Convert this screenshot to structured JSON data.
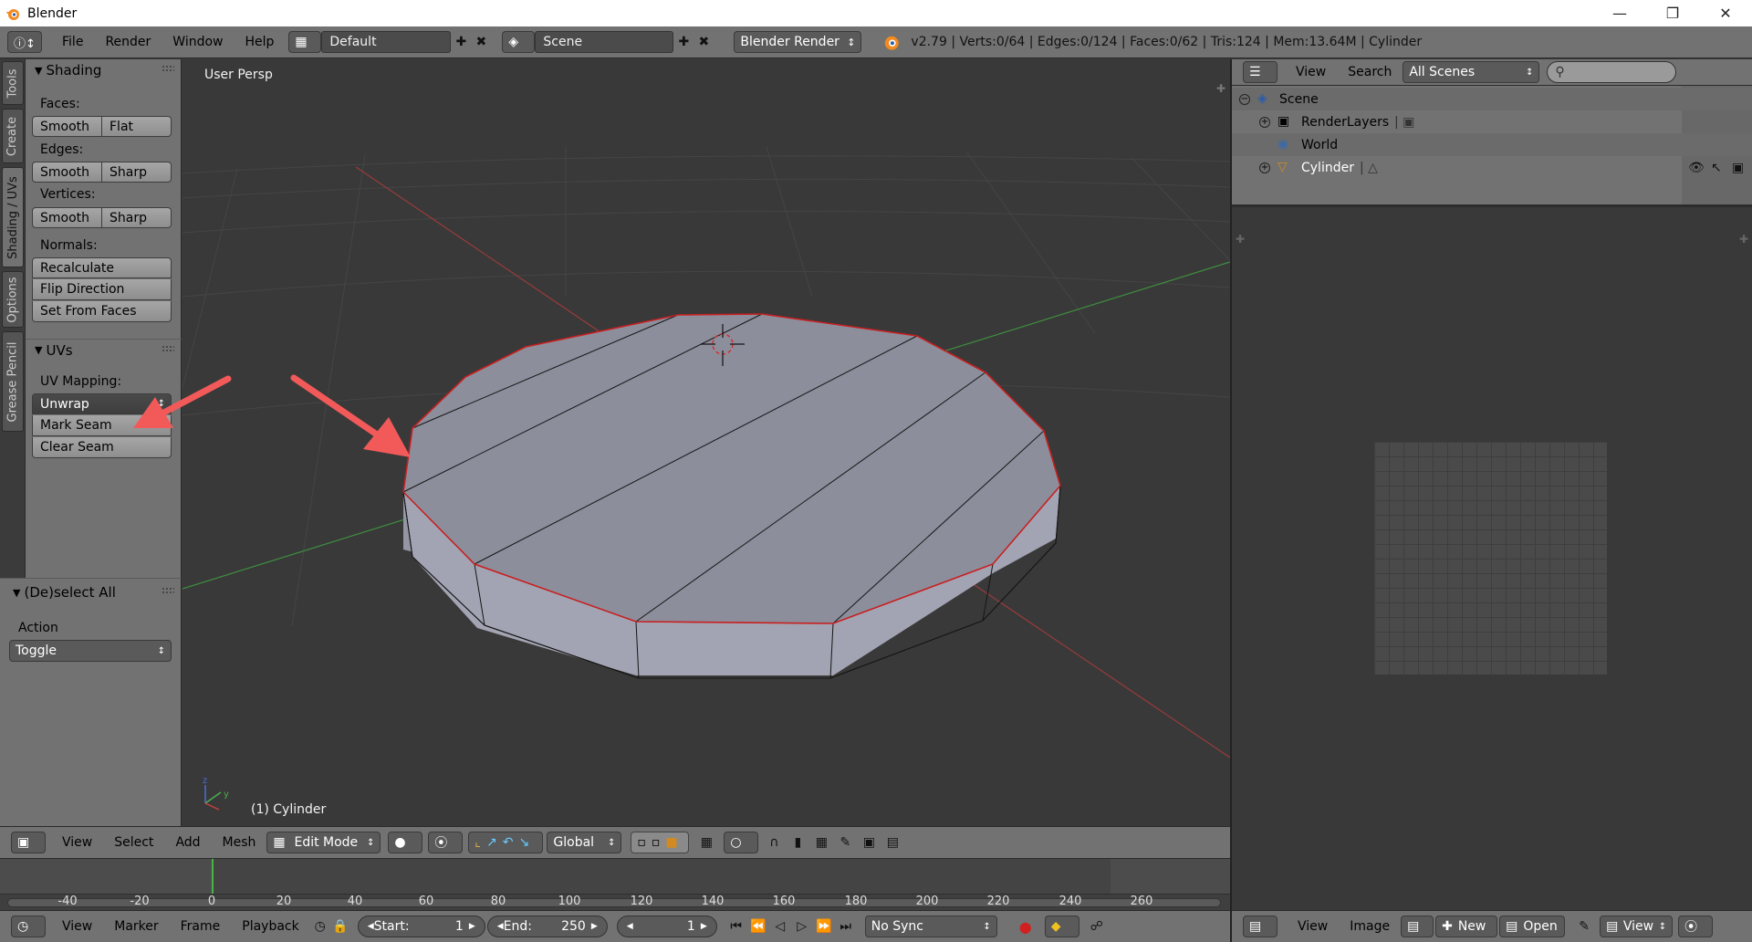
{
  "window": {
    "title": "Blender",
    "controls": [
      "minimize",
      "restore",
      "close"
    ]
  },
  "info_header": {
    "menus": [
      "File",
      "Render",
      "Window",
      "Help"
    ],
    "screen_layout": "Default",
    "scene": "Scene",
    "render_engine": "Blender Render",
    "stats": "v2.79 | Verts:0/64 | Edges:0/124 | Faces:0/62 | Tris:124 | Mem:13.64M | Cylinder"
  },
  "left_tabs": [
    "Tools",
    "Create",
    "Shading / UVs",
    "Options",
    "Grease Pencil"
  ],
  "toolshelf": {
    "shading": {
      "title": "Shading",
      "faces_label": "Faces:",
      "faces": [
        "Smooth",
        "Flat"
      ],
      "edges_label": "Edges:",
      "edges": [
        "Smooth",
        "Sharp"
      ],
      "vertices_label": "Vertices:",
      "vertices": [
        "Smooth",
        "Sharp"
      ],
      "normals_label": "Normals:",
      "normals": [
        "Recalculate",
        "Flip Direction",
        "Set From Faces"
      ]
    },
    "uvs": {
      "title": "UVs",
      "mapping_label": "UV Mapping:",
      "unwrap": "Unwrap",
      "mark_seam": "Mark Seam",
      "clear_seam": "Clear Seam"
    },
    "operator": {
      "title": "(De)select All",
      "action_label": "Action",
      "action_value": "Toggle"
    }
  },
  "viewport": {
    "view_name": "User Persp",
    "object_label": "(1) Cylinder",
    "axis_colors": {
      "x": "#c84040",
      "y": "#4caf50",
      "z": "#4a6fd6"
    },
    "seam_color": "#d02020",
    "mesh_color": "#8a8b99",
    "arrow_color": "#f25a5a"
  },
  "view3d_header": {
    "menus": [
      "View",
      "Select",
      "Add",
      "Mesh"
    ],
    "mode": "Edit Mode",
    "orientation": "Global"
  },
  "timeline": {
    "ticks": [
      "-40",
      "-20",
      "0",
      "20",
      "40",
      "60",
      "80",
      "100",
      "120",
      "140",
      "160",
      "180",
      "200",
      "220",
      "240",
      "260"
    ],
    "current_frame_tick": "0"
  },
  "timeline_header": {
    "menus": [
      "View",
      "Marker",
      "Frame",
      "Playback"
    ],
    "start_label": "Start:",
    "start_value": "1",
    "end_label": "End:",
    "end_value": "250",
    "current_frame": "1",
    "sync": "No Sync"
  },
  "outliner": {
    "header_menus": [
      "View",
      "Search"
    ],
    "filter": "All Scenes",
    "search_placeholder": "",
    "rows": [
      {
        "label": "Scene",
        "icon": "scene-icon"
      },
      {
        "label": "RenderLayers",
        "icon": "render-layers-icon"
      },
      {
        "label": "World",
        "icon": "world-icon"
      },
      {
        "label": "Cylinder",
        "icon": "mesh-object-icon"
      }
    ]
  },
  "uv_header": {
    "menus": [
      "View",
      "Image"
    ],
    "new_label": "New",
    "open_label": "Open",
    "view_label": "View"
  }
}
